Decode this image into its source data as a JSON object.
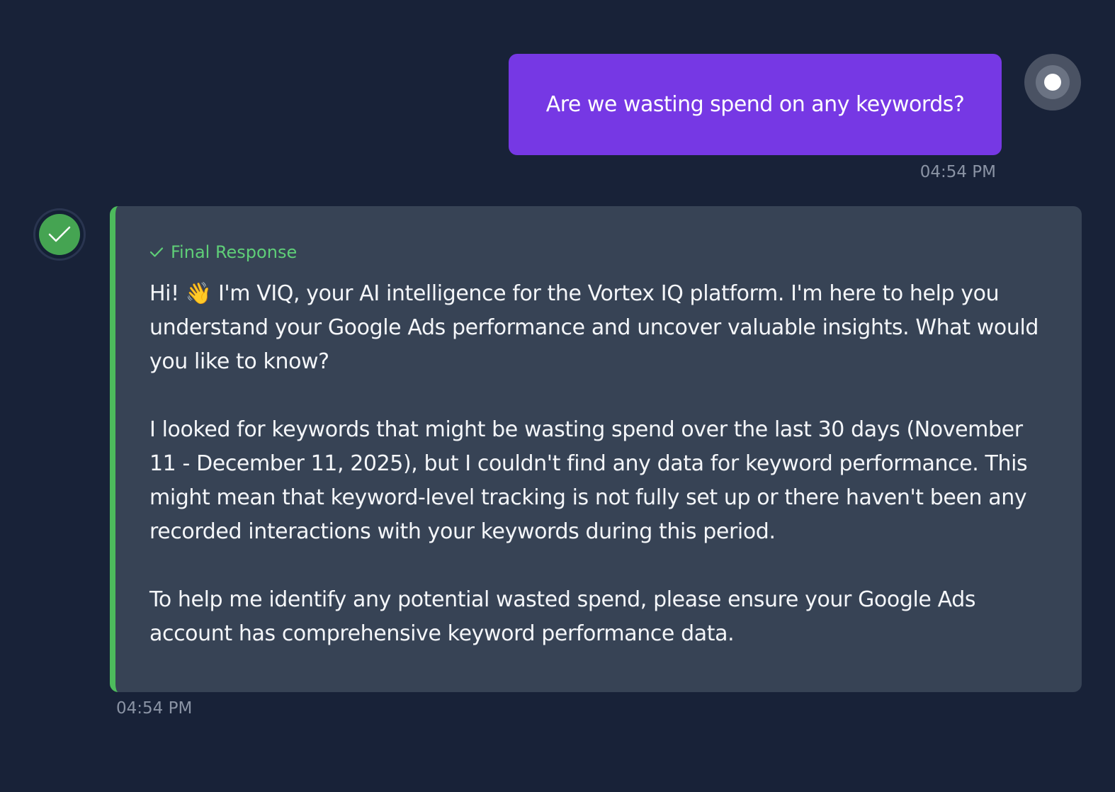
{
  "user_message": {
    "text": "Are we wasting spend on any keywords?",
    "time": "04:54 PM"
  },
  "assistant_message": {
    "status_label": "Final Response",
    "paragraphs": [
      "Hi! 👋 I'm VIQ, your AI intelligence for the Vortex IQ platform. I'm here to help you understand your Google Ads performance and uncover valuable insights. What would you like to know?",
      "I looked for keywords that might be wasting spend over the last 30 days (November 11 - December 11, 2025), but I couldn't find any data for keyword performance. This might mean that keyword-level tracking is not fully set up or there haven't been any recorded interactions with your keywords during this period.",
      "To help me identify any potential wasted spend, please ensure your Google Ads account has comprehensive keyword performance data."
    ],
    "time": "04:54 PM"
  },
  "colors": {
    "background": "#182238",
    "user_bubble": "#7638e4",
    "assistant_card": "#374355",
    "accent_green": "#4dbb5c"
  },
  "icons": {
    "user_avatar": "user-avatar-icon",
    "assistant_avatar": "check-circle-icon",
    "status": "check-icon"
  }
}
